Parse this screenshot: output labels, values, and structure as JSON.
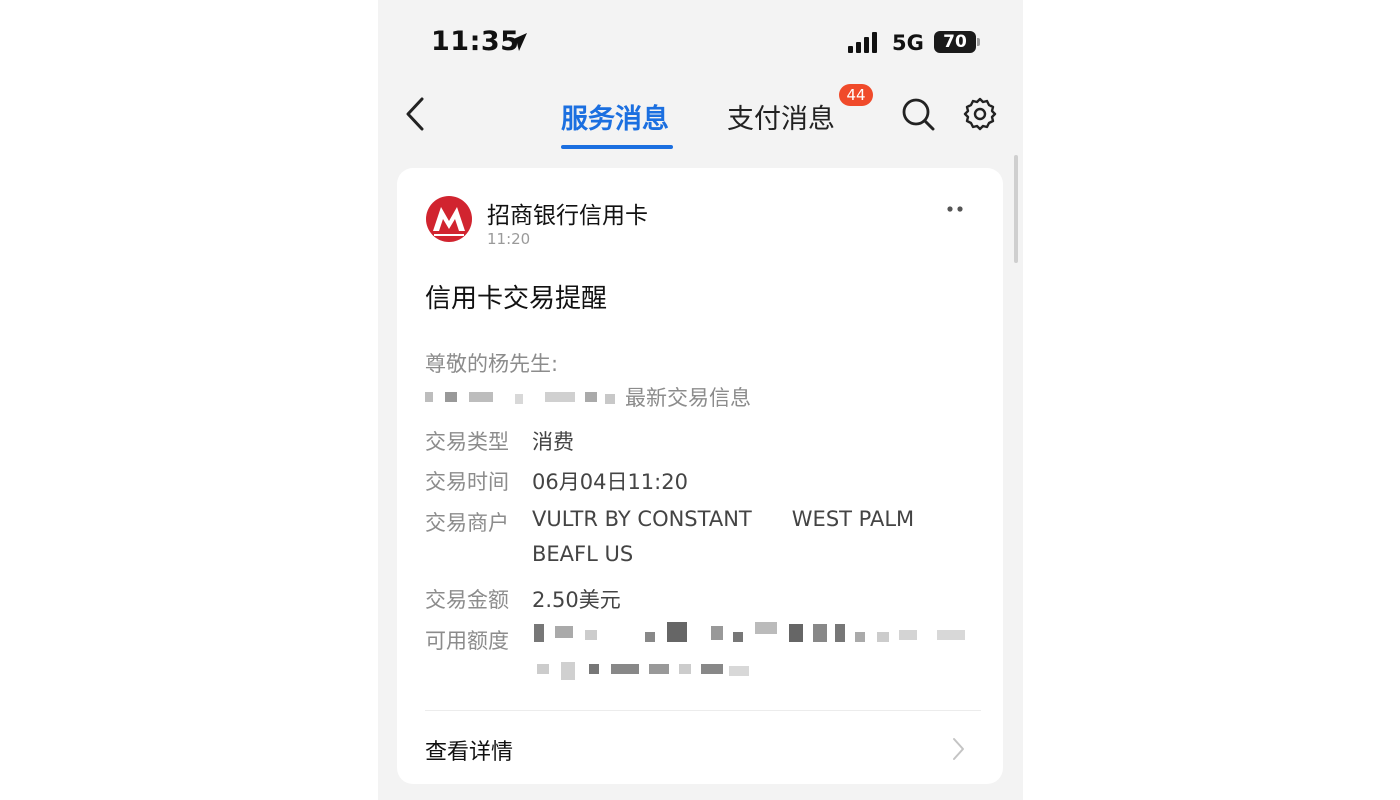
{
  "status_bar": {
    "time": "11:35",
    "network": "5G",
    "battery": "70"
  },
  "nav": {
    "tab_service": "服务消息",
    "tab_pay": "支付消息",
    "pay_badge": "44"
  },
  "message": {
    "sender": "招商银行信用卡",
    "time": "11:20",
    "title": "信用卡交易提醒",
    "greeting": "尊敬的杨先生:",
    "intro_suffix": "最新交易信息",
    "rows": [
      {
        "label": "交易类型",
        "value": "消费"
      },
      {
        "label": "交易时间",
        "value": "06月04日11:20"
      },
      {
        "label": "交易商户",
        "value": "VULTR BY CONSTANT      WEST PALM",
        "value2": "BEAFL US"
      },
      {
        "label": "交易金额",
        "value": "2.50美元"
      },
      {
        "label": "可用额度",
        "value": ""
      }
    ],
    "details_link": "查看详情"
  },
  "colors": {
    "accent": "#1b6fe0",
    "badge": "#f04a2a",
    "brand_red": "#d1242f"
  }
}
